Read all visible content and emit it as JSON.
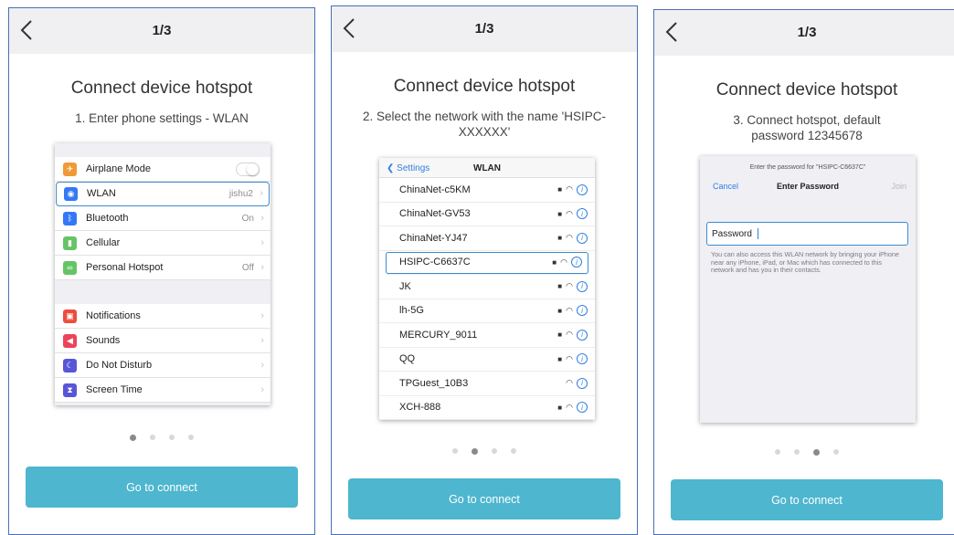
{
  "panels": [
    {
      "nav_title": "1/3",
      "title": "Connect device hotspot",
      "subtitle": "1. Enter phone settings - WLAN",
      "settings": {
        "group1": [
          {
            "label": "Airplane Mode",
            "icon": "airplane-icon",
            "color": "#f09a37",
            "value": "",
            "toggle": true
          },
          {
            "label": "WLAN",
            "icon": "wifi-icon",
            "color": "#3478f6",
            "value": "jishu2",
            "highlight": true
          },
          {
            "label": "Bluetooth",
            "icon": "bluetooth-icon",
            "color": "#3478f6",
            "value": "On"
          },
          {
            "label": "Cellular",
            "icon": "cellular-icon",
            "color": "#65c466",
            "value": ""
          },
          {
            "label": "Personal Hotspot",
            "icon": "hotspot-icon",
            "color": "#65c466",
            "value": "Off"
          }
        ],
        "group2": [
          {
            "label": "Notifications",
            "icon": "notifications-icon",
            "color": "#eb4d3d",
            "value": ""
          },
          {
            "label": "Sounds",
            "icon": "sounds-icon",
            "color": "#eb445a",
            "value": ""
          },
          {
            "label": "Do Not Disturb",
            "icon": "moon-icon",
            "color": "#5856d6",
            "value": ""
          },
          {
            "label": "Screen Time",
            "icon": "hourglass-icon",
            "color": "#5856d6",
            "value": ""
          }
        ]
      },
      "page_dot": 0,
      "button_label": "Go to connect"
    },
    {
      "nav_title": "1/3",
      "title": "Connect device hotspot",
      "subtitle": "2. Select the network with the name 'HSIPC-XXXXXX'",
      "wlan": {
        "back_label": "Settings",
        "header": "WLAN",
        "networks": [
          {
            "name": "ChinaNet-c5KM",
            "locked": true
          },
          {
            "name": "ChinaNet-GV53",
            "locked": true
          },
          {
            "name": "ChinaNet-YJ47",
            "locked": true
          },
          {
            "name": "HSIPC-C6637C",
            "locked": true,
            "highlight": true
          },
          {
            "name": "JK",
            "locked": true
          },
          {
            "name": "lh-5G",
            "locked": true
          },
          {
            "name": "MERCURY_9011",
            "locked": true
          },
          {
            "name": "QQ",
            "locked": true
          },
          {
            "name": "TPGuest_10B3",
            "locked": false
          },
          {
            "name": "XCH-888",
            "locked": true
          }
        ]
      },
      "page_dot": 1,
      "button_label": "Go to connect"
    },
    {
      "nav_title": "1/3",
      "title": "Connect device hotspot",
      "subtitle": "3. Connect hotspot, default password 12345678",
      "password_dialog": {
        "hint": "Enter the password for \"HSIPC-C6637C\"",
        "cancel": "Cancel",
        "title": "Enter Password",
        "join": "Join",
        "field_label": "Password",
        "note": "You can also access this WLAN network by bringing your iPhone near any iPhone, iPad, or Mac which has connected to this network and has you in their contacts."
      },
      "page_dot": 2,
      "button_label": "Go to connect"
    }
  ],
  "dots_count": 4,
  "colors": {
    "accent": "#4eb6cf",
    "highlight_border": "#3c8ccf",
    "ios_blue": "#2f7fe0"
  }
}
